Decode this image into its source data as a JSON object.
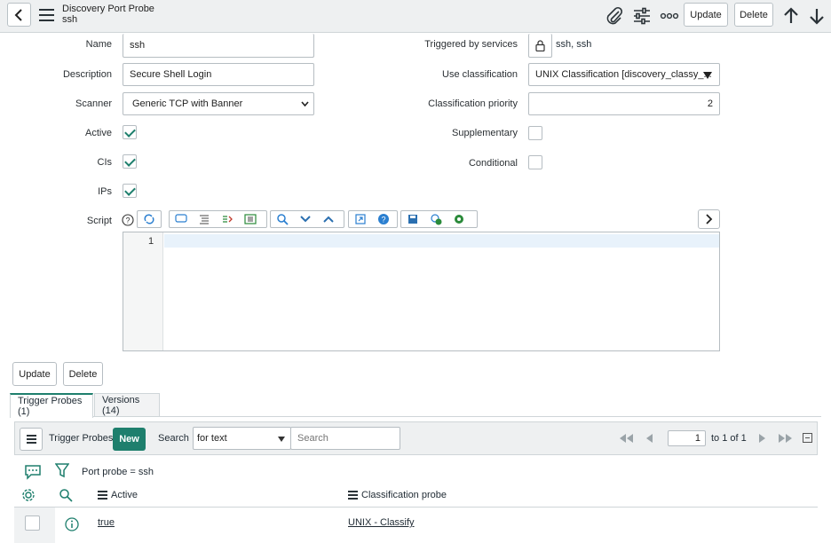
{
  "header": {
    "title": "Discovery Port Probe",
    "subtitle": "ssh",
    "update_label": "Update",
    "delete_label": "Delete"
  },
  "form": {
    "name_label": "Name",
    "name_value": "ssh",
    "description_label": "Description",
    "description_value": "Secure Shell Login",
    "scanner_label": "Scanner",
    "scanner_value": "Generic TCP with Banner",
    "active_label": "Active",
    "active_checked": true,
    "cis_label": "CIs",
    "cis_checked": true,
    "ips_label": "IPs",
    "ips_checked": true,
    "triggered_label": "Triggered by services",
    "triggered_value": "ssh, ssh",
    "use_class_label": "Use classification",
    "use_class_value": "UNIX Classification [discovery_classy_...",
    "class_priority_label": "Classification priority",
    "class_priority_value": "2",
    "supplementary_label": "Supplementary",
    "supplementary_checked": false,
    "conditional_label": "Conditional",
    "conditional_checked": false,
    "script_label": "Script",
    "script_line_number": "1"
  },
  "actions": {
    "update_label": "Update",
    "delete_label": "Delete"
  },
  "tabs": [
    {
      "label": "Trigger Probes (1)",
      "active": true
    },
    {
      "label": "Versions (14)",
      "active": false
    }
  ],
  "related_list": {
    "title": "Trigger Probes",
    "new_label": "New",
    "search_label": "Search",
    "search_field_value": "for text",
    "search_placeholder": "Search",
    "page_value": "1",
    "page_range": "to 1 of 1",
    "filter_text": "Port probe = ssh",
    "columns": [
      "Active",
      "Classification probe"
    ],
    "rows": [
      {
        "active": "true",
        "classification_probe": "UNIX - Classify"
      }
    ]
  },
  "colors": {
    "accent": "#1e7f6d",
    "header_bg": "#eef0f1"
  }
}
